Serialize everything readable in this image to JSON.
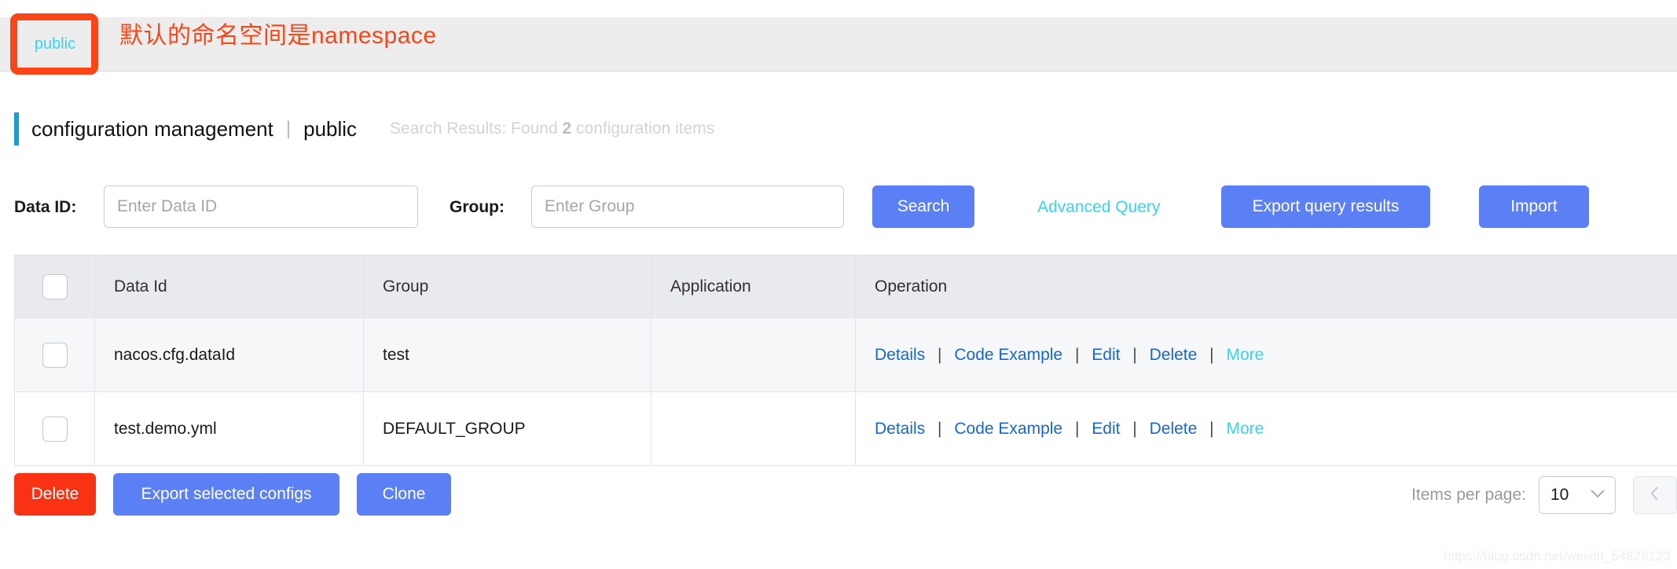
{
  "namespace": {
    "tab_label": "public",
    "annotation_text": "默认的命名空间是namespace",
    "annotation_color": "#fa4616",
    "tab_text_color": "#33d6f0"
  },
  "breadcrumb": {
    "title": "configuration management",
    "separator": "|",
    "namespace": "public",
    "search_summary_prefix": "Search Results: Found",
    "search_summary_count": "2",
    "search_summary_suffix": "configuration items"
  },
  "query_form": {
    "data_id_label": "Data ID:",
    "data_id_value": "",
    "data_id_placeholder": "Enter Data ID",
    "group_label": "Group:",
    "group_value": "",
    "group_placeholder": "Enter Group",
    "search_label": "Search",
    "advanced_query_label": "Advanced Query",
    "export_query_results_label": "Export query results",
    "import_label": "Import"
  },
  "table": {
    "columns": [
      "Data Id",
      "Group",
      "Application",
      "Operation"
    ],
    "rows": [
      {
        "checked": false,
        "data_id": "nacos.cfg.dataId",
        "group": "test",
        "application": "",
        "operations": [
          "Details",
          "Code Example",
          "Edit",
          "Delete",
          "More"
        ]
      },
      {
        "checked": false,
        "data_id": "test.demo.yml",
        "group": "DEFAULT_GROUP",
        "application": "",
        "operations": [
          "Details",
          "Code Example",
          "Edit",
          "Delete",
          "More"
        ]
      }
    ],
    "operation_separator": "|"
  },
  "footer": {
    "delete_label": "Delete",
    "export_selected_label": "Export selected configs",
    "clone_label": "Clone",
    "items_per_page_label": "Items per page:",
    "page_size_value": "10",
    "prev_page_icon": "chevron-left-icon",
    "dropdown_icon": "chevron-down-icon"
  },
  "watermark": {
    "text": "https://blog.csdn.net/weixin_54826123"
  }
}
